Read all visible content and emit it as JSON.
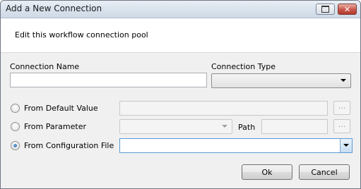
{
  "window": {
    "title": "Add a New Connection",
    "controls": {
      "restore": "restore-icon",
      "close": "close-icon",
      "close_glyph": "✕"
    }
  },
  "header": {
    "description": "Edit this workflow connection pool"
  },
  "form": {
    "connection_name": {
      "label": "Connection Name",
      "value": ""
    },
    "connection_type": {
      "label": "Connection Type",
      "selected": ""
    },
    "source_options": [
      {
        "label": "From Default Value",
        "checked": false
      },
      {
        "label": "From Parameter",
        "checked": false
      },
      {
        "label": "From Configuration File",
        "checked": true
      }
    ],
    "path_label": "Path",
    "ellipsis": "...",
    "config_file_value": ""
  },
  "buttons": {
    "ok": "Ok",
    "cancel": "Cancel"
  }
}
